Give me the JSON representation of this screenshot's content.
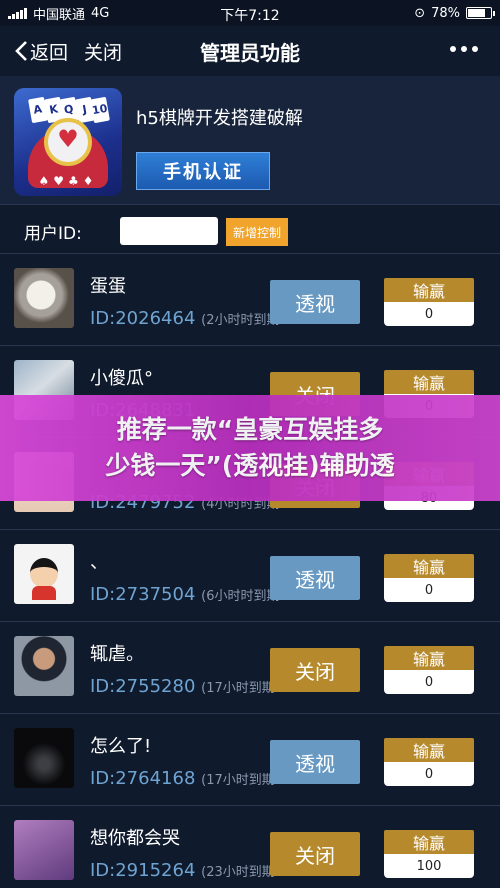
{
  "status_bar": {
    "carrier": "中国联通",
    "network": "4G",
    "time": "下午7:12",
    "battery": "78%",
    "battery_level": 0.78
  },
  "nav": {
    "back_label": "返回",
    "close_label": "关闭",
    "title": "管理员功能"
  },
  "app": {
    "logo_cards": [
      "A",
      "K",
      "Q",
      "J",
      "10"
    ],
    "logo_suits": "♠♥♣♦",
    "name": "h5棋牌开发搭建破解",
    "verify_label": "手机认证"
  },
  "uid_filter": {
    "label": "用户ID:",
    "value": "",
    "add_label": "新增控制"
  },
  "users": [
    {
      "name": "蛋蛋",
      "id": "ID:2026464",
      "note": "(2小时时到期",
      "action": "透视",
      "win_label": "输赢",
      "win_value": "0"
    },
    {
      "name": "小傻瓜°",
      "id": "ID:2648831",
      "note": "",
      "action": "关闭",
      "win_label": "输赢",
      "win_value": "0"
    },
    {
      "name": "",
      "id": "ID:2479752",
      "note": "(4小时时到期",
      "action": "关闭",
      "win_label": "输赢",
      "win_value": "80"
    },
    {
      "name": "、",
      "id": "ID:2737504",
      "note": "(6小时时到期",
      "action": "透视",
      "win_label": "输赢",
      "win_value": "0"
    },
    {
      "name": "辄虐。",
      "id": "ID:2755280",
      "note": "(17小时到期",
      "action": "关闭",
      "win_label": "输赢",
      "win_value": "0"
    },
    {
      "name": "怎么了!",
      "id": "ID:2764168",
      "note": "(17小时到期",
      "action": "透视",
      "win_label": "输赢",
      "win_value": "0"
    },
    {
      "name": "想你都会哭",
      "id": "ID:2915264",
      "note": "(23小时到期",
      "action": "关闭",
      "win_label": "输赢",
      "win_value": "100"
    }
  ],
  "banner": {
    "line1": "推荐一款“皇豪互娱挂多",
    "line2": "少钱一天”(透视挂)辅助透"
  },
  "colors": {
    "background": "#0f1a2c",
    "see_button": "#6899c3",
    "close_button": "#b68a2c",
    "id_text": "#6fa4d2",
    "banner": "#c43ac8",
    "add_button": "#f1a42c"
  }
}
